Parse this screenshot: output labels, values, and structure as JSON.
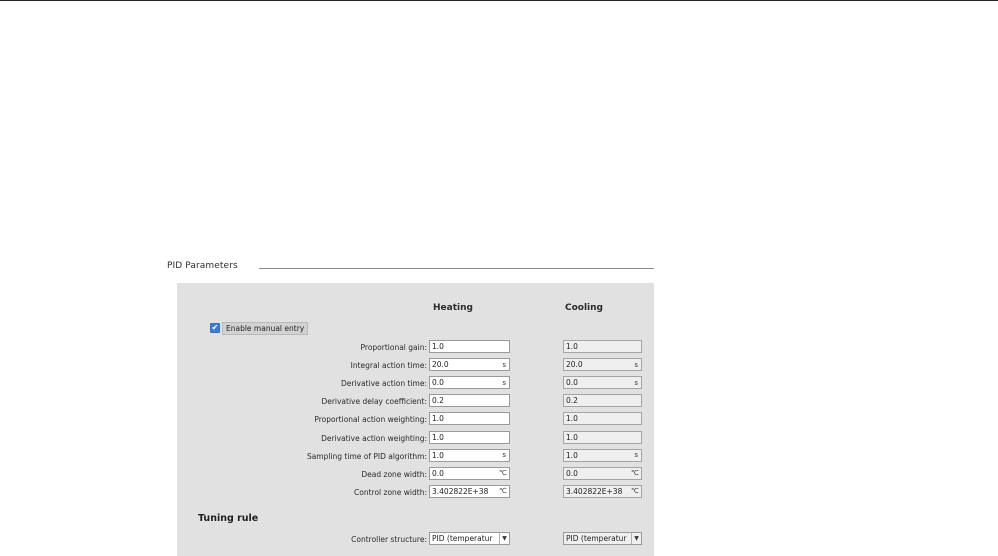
{
  "section": {
    "title": "PID Parameters"
  },
  "columns": {
    "heating": "Heating",
    "cooling": "Cooling"
  },
  "manual_entry": {
    "label": "Enable manual entry",
    "checked": true
  },
  "parameters": [
    {
      "label": "Proportional gain:",
      "heating": "1.0",
      "heating_unit": "",
      "cooling": "1.0",
      "cooling_unit": ""
    },
    {
      "label": "Integral action time:",
      "heating": "20.0",
      "heating_unit": "s",
      "cooling": "20.0",
      "cooling_unit": "s"
    },
    {
      "label": "Derivative action time:",
      "heating": "0.0",
      "heating_unit": "s",
      "cooling": "0.0",
      "cooling_unit": "s"
    },
    {
      "label": "Derivative delay coefficient:",
      "heating": "0.2",
      "heating_unit": "",
      "cooling": "0.2",
      "cooling_unit": ""
    },
    {
      "label": "Proportional action weighting:",
      "heating": "1.0",
      "heating_unit": "",
      "cooling": "1.0",
      "cooling_unit": ""
    },
    {
      "label": "Derivative action weighting:",
      "heating": "1.0",
      "heating_unit": "",
      "cooling": "1.0",
      "cooling_unit": ""
    },
    {
      "label": "Sampling time of PID algorithm:",
      "heating": "1.0",
      "heating_unit": "s",
      "cooling": "1.0",
      "cooling_unit": "s"
    },
    {
      "label": "Dead zone width:",
      "heating": "0.0",
      "heating_unit": "℃",
      "cooling": "0.0",
      "cooling_unit": "℃"
    },
    {
      "label": "Control zone width:",
      "heating": "3.402822E+38",
      "heating_unit": "℃",
      "cooling": "3.402822E+38",
      "cooling_unit": "℃"
    }
  ],
  "tuning": {
    "title": "Tuning rule",
    "controller_structure_label": "Controller structure:",
    "heating_value": "PID (temperatur",
    "cooling_value": "PID (temperatur"
  },
  "icons": {
    "checkbox": "checkmark-icon",
    "dropdown": "chevron-down-icon"
  },
  "colors": {
    "panel_bg": "#e1e1e1",
    "checkbox_accent": "#3b7fd0"
  }
}
